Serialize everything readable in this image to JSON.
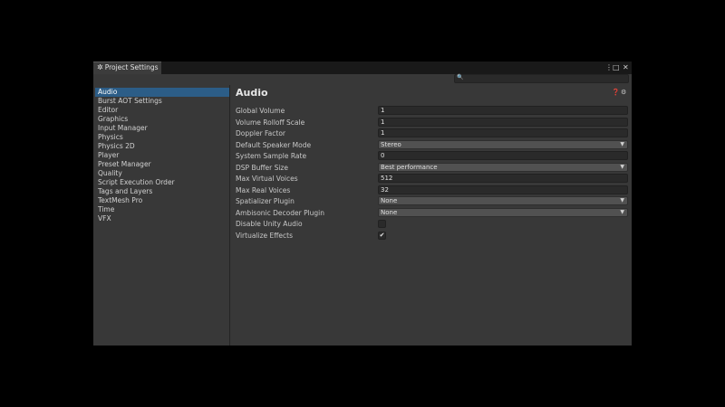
{
  "window": {
    "tab_title": "Project Settings",
    "controls": {
      "menu": "⋮",
      "maximize": "□",
      "close": "✕"
    }
  },
  "search": {
    "placeholder": "",
    "value": ""
  },
  "sidebar": {
    "selected": "Audio",
    "items": [
      {
        "label": "Audio"
      },
      {
        "label": "Burst AOT Settings"
      },
      {
        "label": "Editor"
      },
      {
        "label": "Graphics"
      },
      {
        "label": "Input Manager"
      },
      {
        "label": "Physics"
      },
      {
        "label": "Physics 2D"
      },
      {
        "label": "Player"
      },
      {
        "label": "Preset Manager"
      },
      {
        "label": "Quality"
      },
      {
        "label": "Script Execution Order"
      },
      {
        "label": "Tags and Layers"
      },
      {
        "label": "TextMesh Pro"
      },
      {
        "label": "Time"
      },
      {
        "label": "VFX"
      }
    ]
  },
  "main": {
    "title": "Audio",
    "settings": [
      {
        "label": "Global Volume",
        "type": "number",
        "value": "1"
      },
      {
        "label": "Volume Rolloff Scale",
        "type": "number",
        "value": "1"
      },
      {
        "label": "Doppler Factor",
        "type": "number",
        "value": "1"
      },
      {
        "label": "Default Speaker Mode",
        "type": "dropdown",
        "value": "Stereo"
      },
      {
        "label": "System Sample Rate",
        "type": "number",
        "value": "0"
      },
      {
        "label": "DSP Buffer Size",
        "type": "dropdown",
        "value": "Best performance"
      },
      {
        "label": "Max Virtual Voices",
        "type": "number",
        "value": "512"
      },
      {
        "label": "Max Real Voices",
        "type": "number",
        "value": "32"
      },
      {
        "label": "Spatializer Plugin",
        "type": "dropdown",
        "value": "None"
      },
      {
        "label": "Ambisonic Decoder Plugin",
        "type": "dropdown",
        "value": "None"
      },
      {
        "label": "Disable Unity Audio",
        "type": "checkbox",
        "value": "",
        "checked": false
      },
      {
        "label": "Virtualize Effects",
        "type": "checkbox",
        "value": "✔",
        "checked": true
      }
    ]
  },
  "colors": {
    "selection": "#2c5d87",
    "panel": "#383838",
    "field": "#2a2a2a",
    "background": "#000000"
  }
}
